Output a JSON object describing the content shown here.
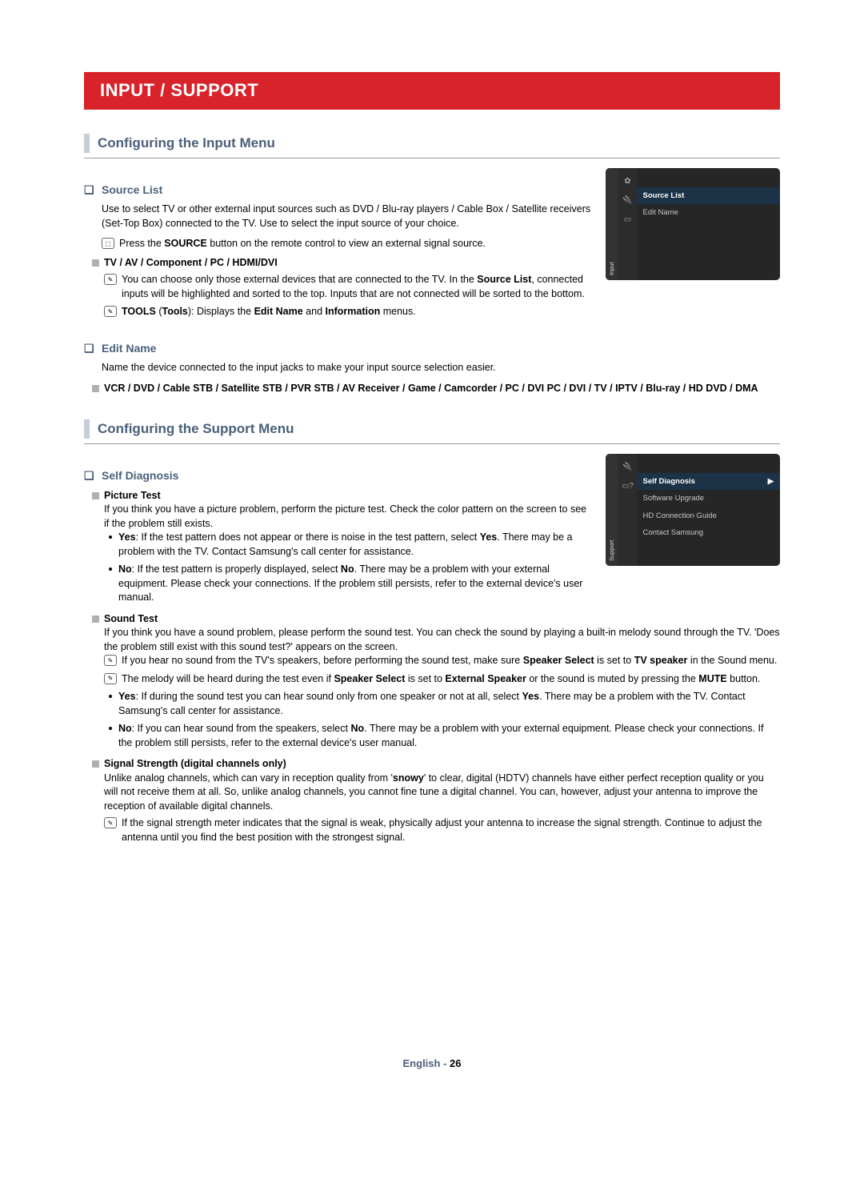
{
  "banner": "INPUT / SUPPORT",
  "sec1": {
    "title": "Configuring the Input Menu",
    "source_list": {
      "h": "Source List",
      "p": "Use to select TV or other external input sources such as DVD / Blu-ray players / Cable Box / Satellite receivers (Set-Top Box) connected to the TV. Use to select the input source of your choice.",
      "remote_pre": "Press the ",
      "remote_bold": "SOURCE",
      "remote_post": " button on the remote control to view an external signal source.",
      "sq_h": "TV / AV / Component / PC / HDMI/DVI",
      "note1_a": "You can choose only those external devices that are connected to the TV. In the ",
      "note1_b": "Source List",
      "note1_c": ", connected inputs will be highlighted and sorted to the top. Inputs that are not connected will be sorted to the bottom.",
      "note2_a": "TOOLS",
      "note2_b": " (",
      "note2_c": "Tools",
      "note2_d": "): Displays the ",
      "note2_e": "Edit Name",
      "note2_f": " and ",
      "note2_g": "Information",
      "note2_h": " menus."
    },
    "edit_name": {
      "h": "Edit Name",
      "p": "Name the device connected to the input jacks to make your input source selection easier.",
      "sq": "VCR / DVD / Cable STB / Satellite STB / PVR STB / AV Receiver / Game / Camcorder / PC / DVI PC / DVI / TV / IPTV / Blu-ray / HD DVD / DMA"
    },
    "menu_shot": {
      "tab": "Input",
      "items": [
        "Source List",
        "Edit Name"
      ]
    }
  },
  "sec2": {
    "title": "Configuring the Support Menu",
    "self_diag": {
      "h": "Self Diagnosis"
    },
    "picture_test": {
      "h": "Picture Test",
      "p": "If you think you have a picture problem, perform the picture test. Check the color pattern on the screen to see if the problem still exists.",
      "yes_a": "Yes",
      "yes_b": ": If the test pattern does not appear or there is noise in the test pattern, select ",
      "yes_c": "Yes",
      "yes_d": ". There may be a problem with the TV. Contact Samsung's call center for assistance.",
      "no_a": "No",
      "no_b": ": If the test pattern is properly displayed, select ",
      "no_c": "No",
      "no_d": ". There may be a problem with your external equipment. Please check your connections. If the problem still persists, refer to the external device's user manual."
    },
    "sound_test": {
      "h": "Sound Test",
      "p": "If you think you have a sound problem, please perform the sound test. You can check the sound by playing a built-in melody sound through the TV. 'Does the problem still exist with this sound test?' appears on the screen.",
      "n1_a": "If you hear no sound from the TV's speakers, before performing the sound test, make sure ",
      "n1_b": "Speaker Select",
      "n1_c": " is set to ",
      "n1_d": "TV speaker",
      "n1_e": " in the Sound menu.",
      "n2_a": "The melody will be heard during the test even if ",
      "n2_b": "Speaker Select",
      "n2_c": " is set to ",
      "n2_d": "External Speaker",
      "n2_e": " or the sound is muted by pressing the ",
      "n2_f": "MUTE",
      "n2_g": " button.",
      "yes_a": "Yes",
      "yes_b": ": If during the sound test you can hear sound only from one speaker or not at all, select ",
      "yes_c": "Yes",
      "yes_d": ". There may be a problem with the TV. Contact Samsung's call center for assistance.",
      "no_a": "No",
      "no_b": ": If you can hear sound from the speakers, select ",
      "no_c": "No",
      "no_d": ". There may be a problem with your external equipment. Please check your connections. If the problem still persists, refer to the external device's user manual."
    },
    "signal": {
      "h": "Signal Strength (digital channels only)",
      "p_a": "Unlike analog channels, which can vary in reception quality from '",
      "p_b": "snowy",
      "p_c": "' to clear, digital (HDTV) channels have either perfect reception quality or you will not receive them at all. So, unlike analog channels, you cannot fine tune a digital channel. You can, however, adjust your antenna to improve the reception of available digital channels.",
      "note": "If the signal strength meter indicates that the signal is weak, physically adjust your antenna to increase the signal strength. Continue to adjust the antenna until you find the best position with the strongest signal."
    },
    "menu_shot": {
      "tab": "Support",
      "items": [
        "Self Diagnosis",
        "Software Upgrade",
        "HD Connection Guide",
        "Contact Samsung"
      ]
    }
  },
  "footer": {
    "lang": "English - ",
    "page": "26"
  }
}
